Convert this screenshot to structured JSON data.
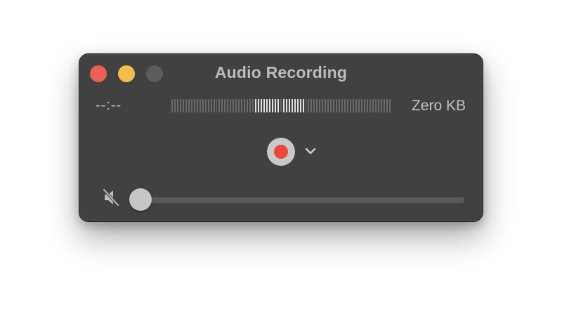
{
  "window": {
    "title": "Audio Recording"
  },
  "controls": {
    "traffic_lights": [
      "close",
      "minimize",
      "zoom"
    ],
    "record_icon": "record-icon",
    "options_icon": "chevron-down-icon",
    "mute_icon": "speaker-muted-icon"
  },
  "status": {
    "elapsed_time": "--:--",
    "file_size": "Zero KB"
  },
  "level_meter": {
    "total_ticks": 79,
    "active_ticks": [
      30,
      31,
      32,
      33,
      34,
      35,
      36,
      37,
      38,
      40,
      41,
      42,
      43,
      44,
      45,
      46,
      47
    ]
  },
  "volume": {
    "level": 0
  },
  "colors": {
    "window_bg": "#414141",
    "close": "#ec5f56",
    "minimize": "#f4be4f",
    "zoom_inactive": "#5c5c5c",
    "record_dot": "#e9473c",
    "record_ring": "#c9c9c9"
  }
}
